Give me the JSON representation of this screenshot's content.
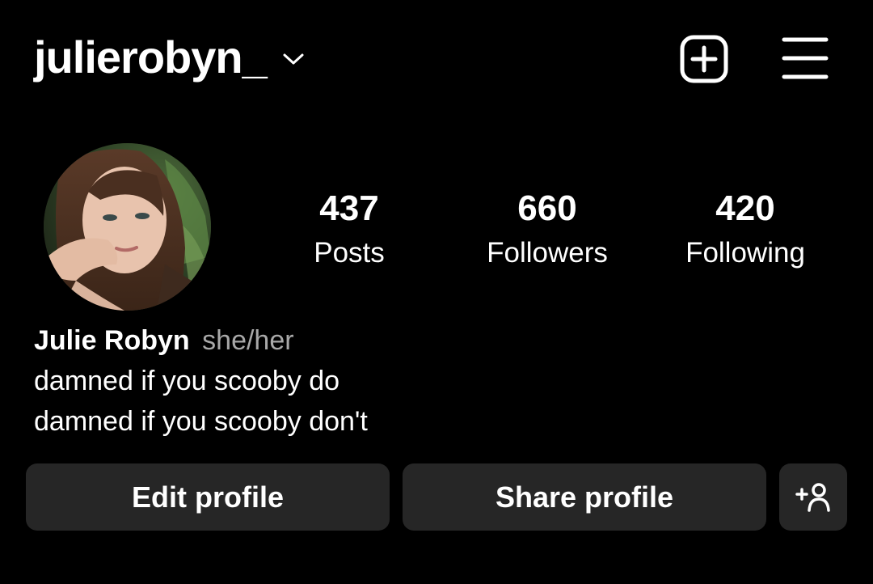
{
  "header": {
    "username": "julierobyn_",
    "icons": {
      "dropdown": "chevron-down-icon",
      "create": "add-square-icon",
      "menu": "hamburger-menu-icon"
    }
  },
  "profile": {
    "avatar_alt": "profile photo",
    "stats": {
      "posts": {
        "value": "437",
        "label": "Posts"
      },
      "followers": {
        "value": "660",
        "label": "Followers"
      },
      "following": {
        "value": "420",
        "label": "Following"
      }
    },
    "bio": {
      "name": "Julie Robyn",
      "pronouns": "she/her",
      "lines": [
        "damned if you scooby do",
        "damned if you scooby don't"
      ]
    }
  },
  "actions": {
    "edit_label": "Edit profile",
    "share_label": "Share profile",
    "add_user_icon": "add-person-icon"
  },
  "colors": {
    "background": "#000000",
    "text": "#ffffff",
    "secondary_text": "#a8a8a8",
    "button_bg": "#262626"
  }
}
